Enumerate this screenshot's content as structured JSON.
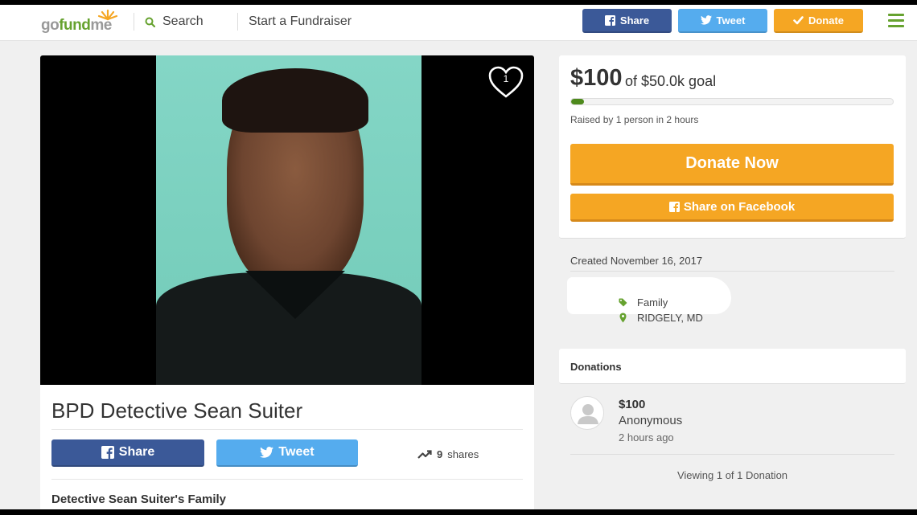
{
  "header": {
    "logo": {
      "part1": "go",
      "part2": "fund",
      "part3": "me"
    },
    "search_label": "Search",
    "start_label": "Start a Fundraiser",
    "share_label": "Share",
    "tweet_label": "Tweet",
    "donate_label": "Donate"
  },
  "campaign": {
    "likes": "1",
    "title": "BPD Detective Sean Suiter",
    "share_label": "Share",
    "tweet_label": "Tweet",
    "shares_count": "9",
    "shares_label": "shares",
    "organizer": "Detective Sean Suiter's Family"
  },
  "goal": {
    "raised": "$100",
    "goal_text": "of $50.0k goal",
    "progress": 0.04,
    "raised_by": "Raised by 1 person in 2 hours",
    "donate_now_label": "Donate Now",
    "share_fb_label": "Share on Facebook"
  },
  "details": {
    "created": "Created November 16, 2017",
    "category": "Family",
    "location": "RIDGELY, MD"
  },
  "donations": {
    "title": "Donations",
    "items": [
      {
        "amount": "$100",
        "name": "Anonymous",
        "time": "2 hours ago"
      }
    ],
    "viewing": "Viewing 1 of 1 Donation"
  },
  "colors": {
    "brand_green": "#66a22f",
    "facebook": "#3b5998",
    "twitter": "#55acee",
    "donate_orange": "#f5a623"
  }
}
